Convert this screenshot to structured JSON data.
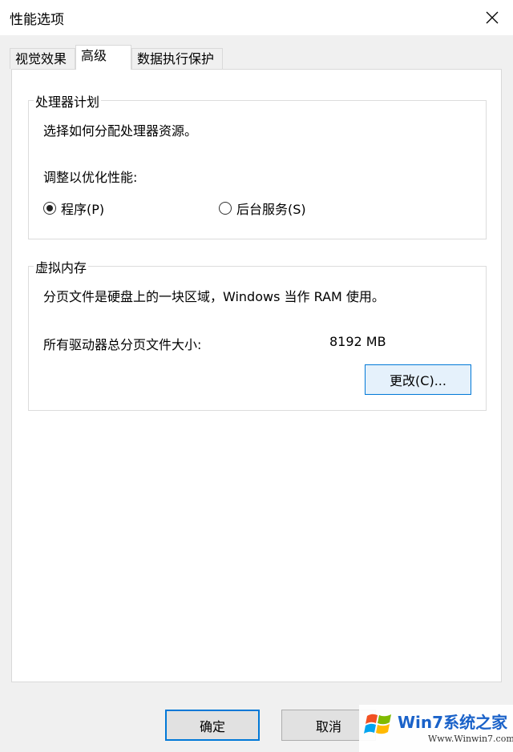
{
  "window": {
    "title": "性能选项"
  },
  "tabs": [
    {
      "label": "视觉效果"
    },
    {
      "label": "高级"
    },
    {
      "label": "数据执行保护"
    }
  ],
  "processor": {
    "title": "处理器计划",
    "description": "选择如何分配处理器资源。",
    "adjust_label": "调整以优化性能:",
    "options": [
      {
        "label": "程序(P)",
        "selected": true
      },
      {
        "label": "后台服务(S)",
        "selected": false
      }
    ]
  },
  "virtual_memory": {
    "title": "虚拟内存",
    "description": "分页文件是硬盘上的一块区域，Windows 当作 RAM 使用。",
    "total_label": "所有驱动器总分页文件大小:",
    "total_value": "8192 MB",
    "change_label": "更改(C)..."
  },
  "footer": {
    "ok_label": "确定",
    "cancel_label": "取消"
  },
  "watermark": {
    "brand": "Win7系统之家",
    "url": "Www.Winwin7.com"
  },
  "colors": {
    "accent": "#0078d7",
    "button_hover": "#e5f1fb",
    "panel_bg": "#ffffff",
    "window_bg": "#f0f0f0"
  }
}
